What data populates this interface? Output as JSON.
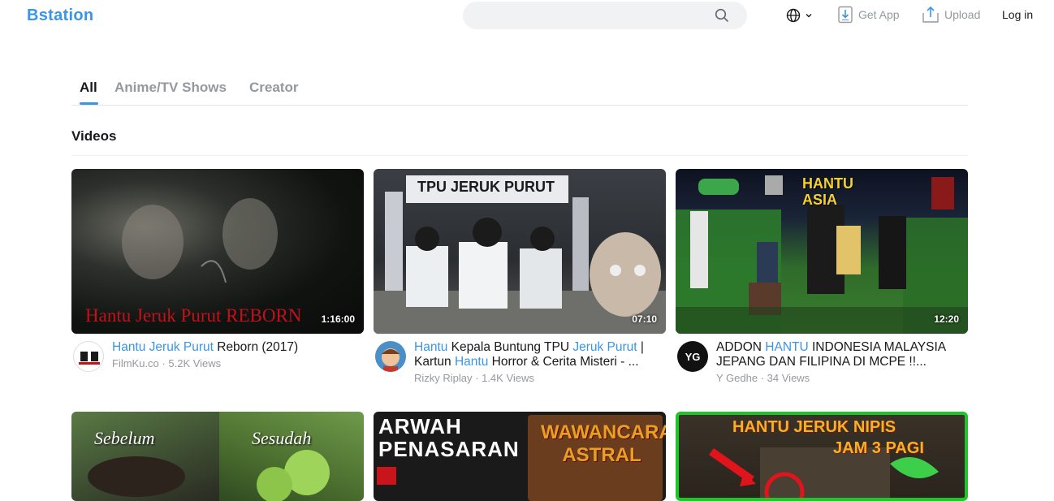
{
  "header": {
    "logo": "Bstation",
    "search_placeholder": "",
    "get_app": "Get App",
    "upload": "Upload",
    "login": "Log in"
  },
  "tabs": [
    "All",
    "Anime/TV Shows",
    "Creator"
  ],
  "section_title": "Videos",
  "videos": [
    {
      "thumb_text": "Hantu Jeruk Purut REBORN",
      "duration": "1:16:00",
      "title_parts": [
        [
          "Hantu Jeruk Purut",
          true
        ],
        [
          " Reborn (2017)",
          false
        ]
      ],
      "channel": "FilmKu.co",
      "views": "5.2K Views"
    },
    {
      "thumb_text": "TPU JERUK PURUT",
      "duration": "07:10",
      "title_parts": [
        [
          "Hantu",
          true
        ],
        [
          " Kepala Buntung TPU ",
          false
        ],
        [
          "Jeruk Purut",
          true
        ],
        [
          " | Kartun ",
          false
        ],
        [
          "Hantu",
          true
        ],
        [
          " Horror & Cerita Misteri - ...",
          false
        ]
      ],
      "channel": "Rizky Riplay",
      "views": "1.4K Views"
    },
    {
      "thumb_text": "HANTU ASIA",
      "duration": "12:20",
      "title_parts": [
        [
          "ADDON ",
          false
        ],
        [
          "HANTU",
          true
        ],
        [
          " INDONESIA MALAYSIA JEPANG DAN FILIPINA DI MCPE !!...",
          false
        ]
      ],
      "channel": "Y Gedhe",
      "views": "34 Views"
    }
  ],
  "row2": [
    {
      "left_text": "Sebelum",
      "right_text": "Sesudah"
    },
    {
      "left_text": "ARWAH PENASARAN",
      "right_text": "WAWANCARA ASTRAL"
    },
    {
      "left_text": "HANTU JERUK NIPIS",
      "right_text": "JAM 3 PAGI"
    }
  ],
  "colors": {
    "accent": "#3a95e8",
    "muted": "#9499a0"
  }
}
